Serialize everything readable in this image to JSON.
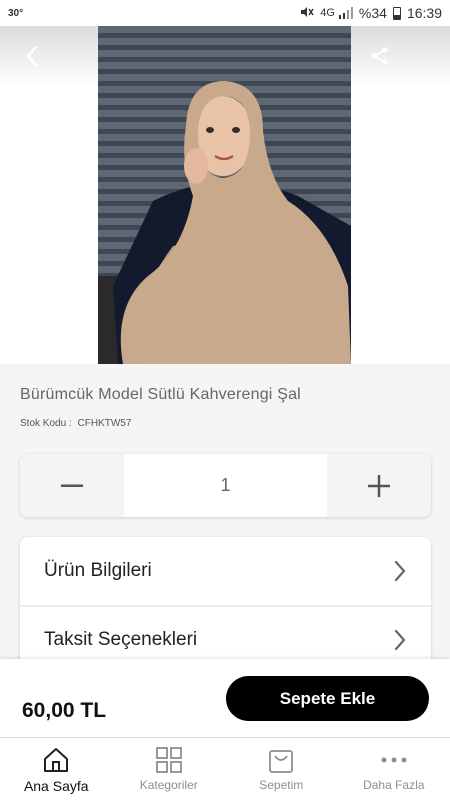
{
  "status_bar": {
    "temperature": "30°",
    "network": "4G",
    "battery": "%34",
    "time": "16:39"
  },
  "product": {
    "title": "Bürümcük Model Sütlü Kahverengi  Şal",
    "sku_label": "Stok Kodu :",
    "sku_value": "CFHKTW57",
    "image_icon": "product-photo",
    "quantity": "1"
  },
  "info_rows": [
    {
      "label": "Ürün Bilgileri"
    },
    {
      "label": "Taksit Seçenekleri"
    }
  ],
  "buy_bar": {
    "price": "60,00 TL",
    "add_to_cart_label": "Sepete Ekle"
  },
  "nav": {
    "items": [
      {
        "label": "Ana Sayfa",
        "icon": "home-icon",
        "active": true
      },
      {
        "label": "Kategoriler",
        "icon": "grid-icon",
        "active": false
      },
      {
        "label": "Sepetim",
        "icon": "bag-icon",
        "active": false
      },
      {
        "label": "Daha Fazla",
        "icon": "more-icon",
        "active": false
      }
    ]
  },
  "colors": {
    "accent": "#000000",
    "background": "#f5f5f5",
    "nav_inactive": "#8a8f94"
  }
}
